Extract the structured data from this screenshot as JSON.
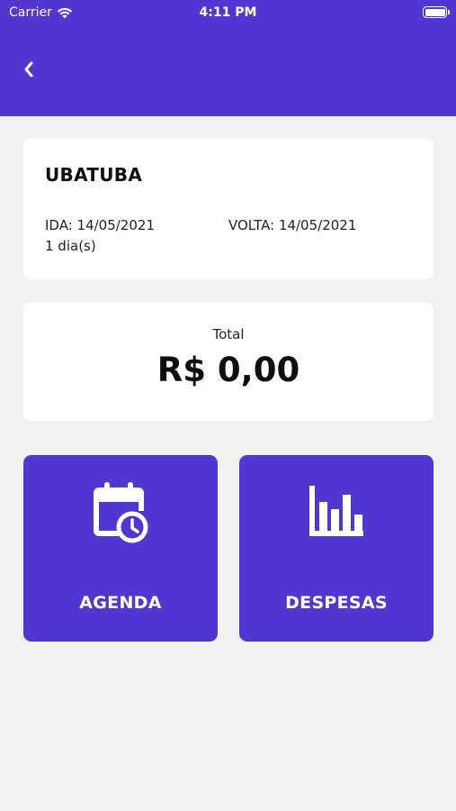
{
  "status_bar": {
    "carrier": "Carrier",
    "time": "4:11 PM"
  },
  "header": {
    "back_icon": "chevron-left-icon"
  },
  "trip": {
    "name": "UBATUBA",
    "ida": "IDA: 14/05/2021",
    "volta": "VOLTA: 14/05/2021",
    "days": "1 dia(s)"
  },
  "total": {
    "label": "Total",
    "value": "R$ 0,00"
  },
  "tiles": {
    "agenda": {
      "label": "AGENDA",
      "icon": "calendar-clock-icon"
    },
    "despesas": {
      "label": "DESPESAS",
      "icon": "bar-chart-icon"
    }
  },
  "colors": {
    "primary": "#5236d2",
    "background": "#f1f1f1",
    "card": "#ffffff"
  }
}
